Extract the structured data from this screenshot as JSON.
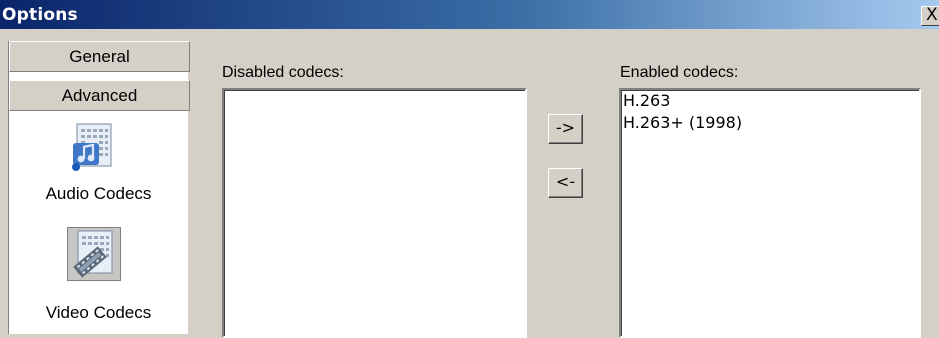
{
  "window": {
    "title": "Options",
    "close_label": "X"
  },
  "sidebar": {
    "tabs": [
      {
        "label": "General"
      },
      {
        "label": "Advanced"
      }
    ],
    "items": [
      {
        "label": "Audio Codecs",
        "icon": "audio-codecs-icon"
      },
      {
        "label": "Video Codecs",
        "icon": "video-codecs-icon"
      }
    ]
  },
  "codecs": {
    "disabled_label": "Disabled codecs:",
    "enabled_label": "Enabled codecs:",
    "disabled_items": [],
    "enabled_items": [
      "H.263",
      "H.263+ (1998)"
    ],
    "enable_button": "->",
    "disable_button": "<-"
  }
}
